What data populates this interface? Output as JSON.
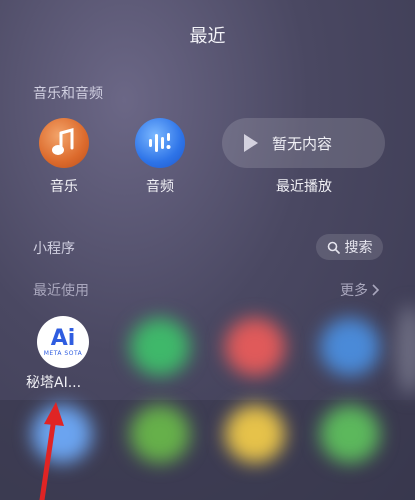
{
  "header": {
    "title": "最近"
  },
  "music_section": {
    "title": "音乐和音频",
    "items": [
      {
        "label": "音乐",
        "icon": "music-note-icon",
        "color": "#dc6a2c"
      },
      {
        "label": "音频",
        "icon": "audio-waveform-icon",
        "color": "#2e74e8"
      }
    ],
    "recent_play": {
      "text": "暂无内容",
      "label": "最近播放",
      "icon": "play-icon"
    }
  },
  "mini_program_section": {
    "title": "小程序",
    "search_label": "搜索",
    "recent_title": "最近使用",
    "more_label": "更多",
    "apps": [
      {
        "label": "秘塔AI...",
        "logo_line1": "Ai",
        "logo_line2": "META SOTA"
      }
    ]
  }
}
